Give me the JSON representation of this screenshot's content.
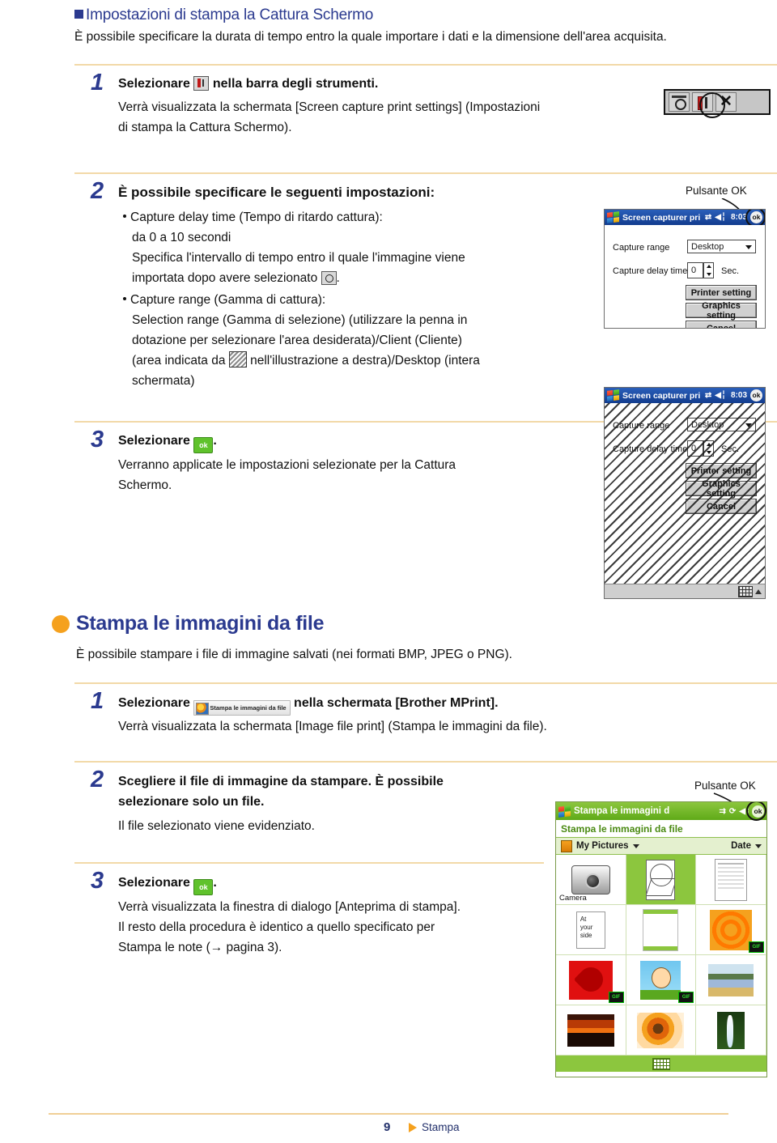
{
  "header": {
    "section_title": "Impostazioni di stampa la Cattura Schermo",
    "intro": "È possibile specificare la durata di tempo entro la quale importare i dati e la dimensione dell'area acquisita."
  },
  "steps_capture": [
    {
      "num": "1",
      "title_a": "Selezionare",
      "title_b": "nella barra degli strumenti.",
      "body_l1": "Verrà visualizzata la schermata [Screen capture print settings] (Impostazioni",
      "body_l2": "di stampa la Cattura Schermo)."
    },
    {
      "num": "2",
      "title": "È possibile specificare le seguenti impostazioni:",
      "b1_l1": "Capture delay time (Tempo di ritardo cattura):",
      "b1_l2": "da 0 a 10 secondi",
      "b1_l3": "Specifica l'intervallo di tempo entro il quale l'immagine viene",
      "b1_l4a": "importata dopo avere selezionato",
      "b1_l4b": ".",
      "b2_l1": "Capture range (Gamma di cattura):",
      "b2_l2": "Selection range (Gamma di selezione) (utilizzare la penna in",
      "b2_l3": "dotazione per selezionare l'area desiderata)/Client (Cliente)",
      "b2_l4a": "(area indicata da",
      "b2_l4b": "nell'illustrazione a destra)/Desktop (intera",
      "b2_l5": "schermata)"
    },
    {
      "num": "3",
      "title_a": "Selezionare",
      "title_b": ".",
      "body_l1": "Verranno applicate le impostazioni selezionate per la Cattura",
      "body_l2": "Schermo."
    }
  ],
  "toolbar_fig": {
    "camera_icon": "camera-icon",
    "tools_icon": "tools-icon",
    "close_label": "✕"
  },
  "callout_ok_1": "Pulsante OK",
  "callout_ok_2": "Pulsante OK",
  "pda_capture": {
    "titlebar": {
      "title": "Screen capturer pri",
      "time": "8:03",
      "ok_label": "ok",
      "connect_icon": "connectivity-icon",
      "volume_icon": "volume-icon"
    },
    "label_range": "Capture range",
    "value_range": "Desktop",
    "label_delay": "Capture delay time",
    "value_delay": "0",
    "unit_sec": "Sec.",
    "btn_printer": "Printer setting",
    "btn_graphics": "Graphics setting",
    "btn_cancel": "Cancel"
  },
  "pda_capture_hatched": {
    "titlebar": {
      "title": "Screen capturer pri",
      "time": "8:03",
      "ok_label": "ok"
    },
    "label_range": "Capture range",
    "value_range": "Desktop",
    "label_delay": "Capture delay time",
    "value_delay": "0",
    "unit_sec": "Sec.",
    "btn_printer": "Printer setting",
    "btn_graphics": "Graphics setting",
    "btn_cancel": "Cancel"
  },
  "section_imagefile": {
    "heading": "Stampa le immagini da file",
    "intro": "È possibile stampare i file di immagine salvati (nei formati BMP, JPEG o PNG)."
  },
  "steps_imagefile": [
    {
      "num": "1",
      "title_a": "Selezionare",
      "button_label": "Stampa le immagini da file",
      "title_b": "nella schermata [Brother MPrint].",
      "body_l1": "Verrà visualizzata la schermata [Image file print] (Stampa le immagini da file)."
    },
    {
      "num": "2",
      "title_l1": "Scegliere il file di immagine da stampare. È possibile",
      "title_l2": "selezionare solo un file.",
      "body_l1": "Il file selezionato viene evidenziato."
    },
    {
      "num": "3",
      "title_a": "Selezionare",
      "title_b": ".",
      "body_l1": "Verrà visualizzata la finestra di dialogo [Anteprima di stampa].",
      "body_l2": "Il resto della procedura è identico a quello specificato per",
      "body_l3": "Stampa le note (→ pagina 3)."
    }
  ],
  "pda_imagefile": {
    "titlebar": {
      "title": "Stampa le immagini d",
      "ok_label": "ok",
      "sync_icon": "sync-icon",
      "rotate_icon": "rotate-icon",
      "volume_icon": "volume-icon"
    },
    "subtitle": "Stampa le immagini da file",
    "folder_label": "My Pictures",
    "sort_label": "Date",
    "thumbnails": [
      {
        "name": "Camera",
        "label": "Camera",
        "kind": "camera",
        "selected": false,
        "gif": false
      },
      {
        "name": "geometry-drawing",
        "label": "",
        "kind": "geo",
        "selected": true,
        "gif": false
      },
      {
        "name": "document-scan",
        "label": "",
        "kind": "doc",
        "selected": false,
        "gif": false
      },
      {
        "name": "at-your-side-card",
        "label": "",
        "kind": "atside",
        "selected": false,
        "gif": false
      },
      {
        "name": "form-page",
        "label": "",
        "kind": "form",
        "selected": false,
        "gif": false
      },
      {
        "name": "orange-rings",
        "label": "",
        "kind": "orange",
        "selected": false,
        "gif": true
      },
      {
        "name": "red-heart",
        "label": "",
        "kind": "heart",
        "selected": false,
        "gif": true
      },
      {
        "name": "cartoon-face",
        "label": "",
        "kind": "face",
        "selected": false,
        "gif": true
      },
      {
        "name": "lake-landscape",
        "label": "",
        "kind": "lake",
        "selected": false,
        "gif": false
      },
      {
        "name": "desert-sunset",
        "label": "",
        "kind": "sunset",
        "selected": false,
        "gif": false
      },
      {
        "name": "sunflower-macro",
        "label": "",
        "kind": "flower",
        "selected": false,
        "gif": false
      },
      {
        "name": "waterfall",
        "label": "",
        "kind": "fall",
        "selected": false,
        "gif": false
      }
    ],
    "gif_badge": "GIF"
  },
  "footer": {
    "page_number": "9",
    "label": "Stampa"
  },
  "colors": {
    "heading_blue": "#2b3a8f",
    "accent_orange": "#f5a11e",
    "rule_cream": "#f2d9a8",
    "ok_green": "#5fc22b",
    "title_blue": "#123c8e",
    "title_green": "#5faa18"
  }
}
